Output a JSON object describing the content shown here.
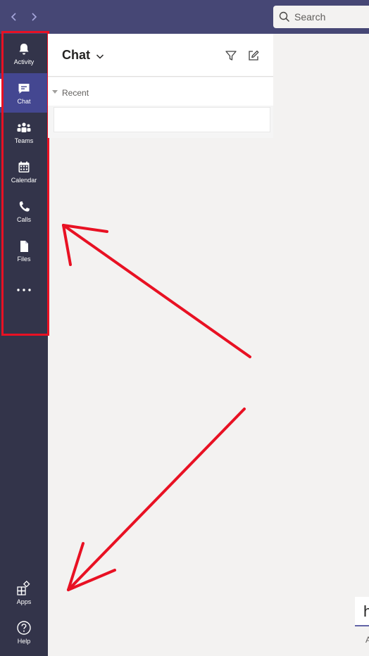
{
  "topbar": {
    "back_icon": "chevron-left-icon",
    "forward_icon": "chevron-right-icon",
    "search_placeholder": "Search",
    "search_icon": "search-icon",
    "color": "#464775"
  },
  "rail": {
    "color": "#33344a",
    "active_color": "#444791",
    "items": [
      {
        "label": "Activity",
        "icon": "bell-icon"
      },
      {
        "label": "Chat",
        "icon": "chat-icon",
        "active": true
      },
      {
        "label": "Teams",
        "icon": "teams-icon"
      },
      {
        "label": "Calendar",
        "icon": "calendar-icon"
      },
      {
        "label": "Calls",
        "icon": "phone-icon"
      },
      {
        "label": "Files",
        "icon": "file-icon"
      },
      {
        "label": "",
        "icon": "more-icon"
      }
    ],
    "bottom_items": [
      {
        "label": "Apps",
        "icon": "apps-icon"
      },
      {
        "label": "Help",
        "icon": "help-icon"
      }
    ]
  },
  "chat_list": {
    "title": "Chat",
    "title_dropdown_icon": "chevron-down-icon",
    "filter_icon": "filter-icon",
    "compose_icon": "compose-icon",
    "section_label": "Recent",
    "section_icon": "caret-down-icon"
  },
  "annotations": {
    "color": "#e81123"
  },
  "partial": {
    "input_text": "h",
    "below_text": "A"
  }
}
